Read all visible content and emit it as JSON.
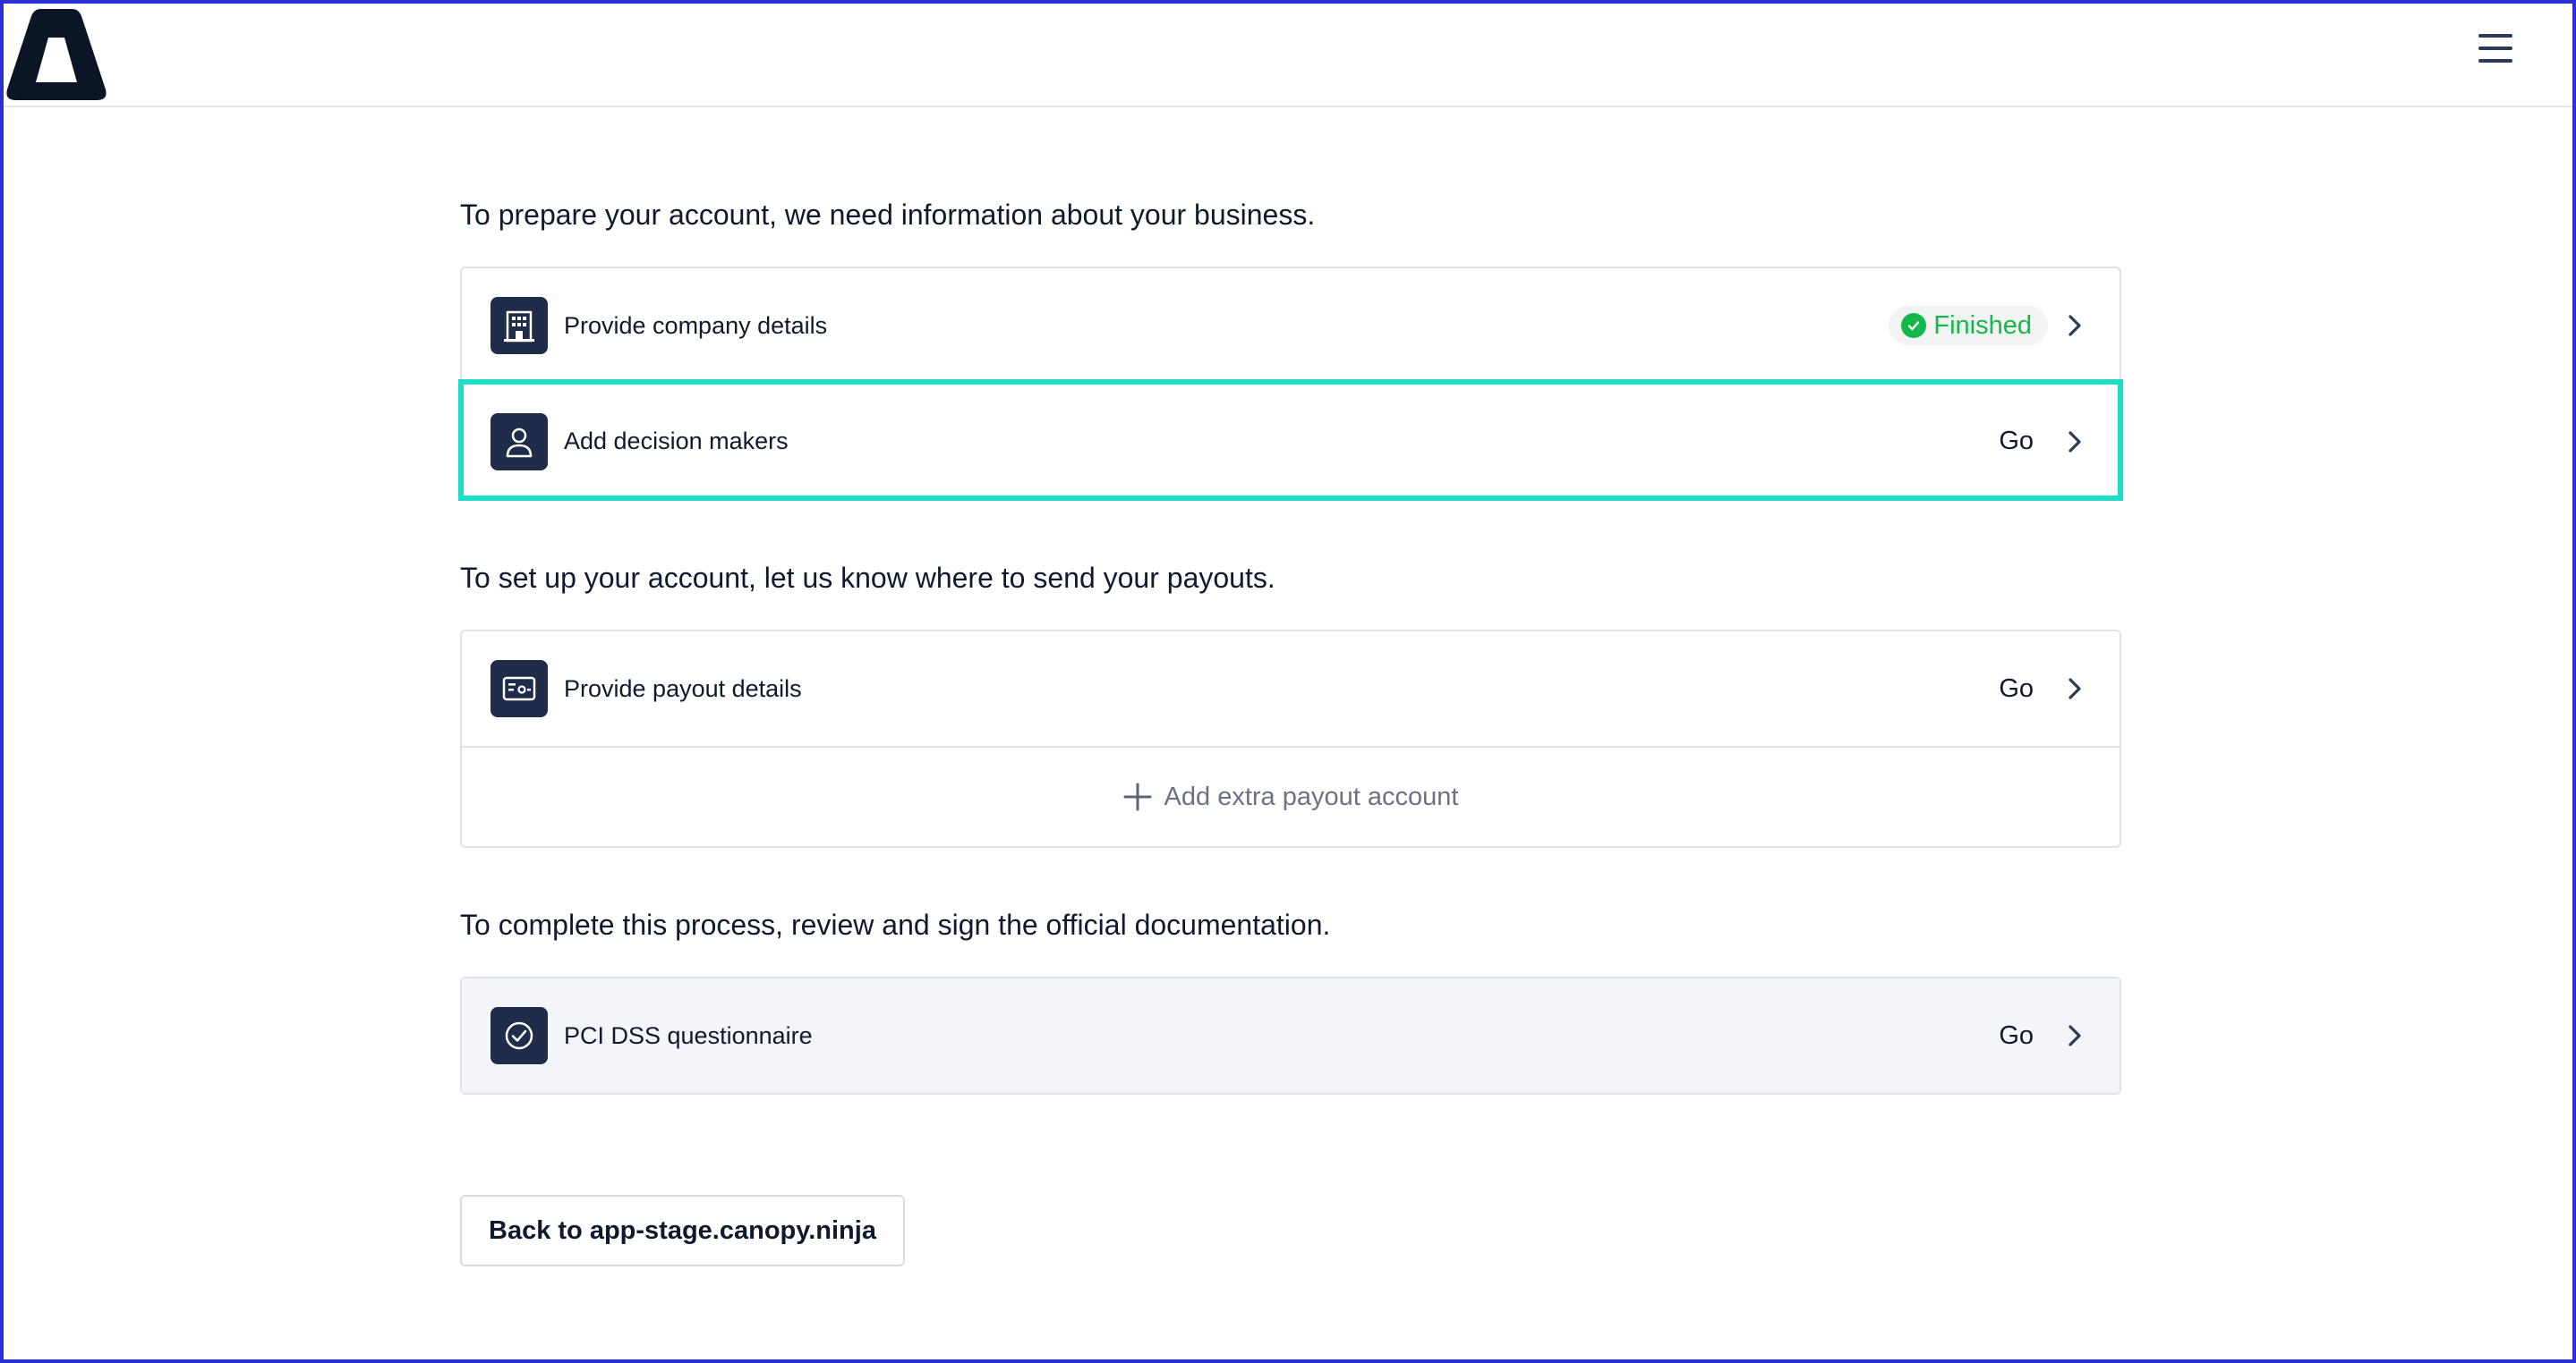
{
  "header": {
    "logo_icon": "triangle-logo-icon",
    "menu_icon": "hamburger-menu-icon"
  },
  "sections": [
    {
      "title": "To prepare your account, we need information about your business.",
      "rows": [
        {
          "label": "Provide company details",
          "icon": "building-icon",
          "status": "Finished",
          "status_type": "badge",
          "status_color": "#14b84a"
        },
        {
          "label": "Add decision makers",
          "icon": "person-icon",
          "status": "Go",
          "highlighted": true,
          "highlight_color": "#1fdcc8"
        }
      ]
    },
    {
      "title": "To set up your account, let us know where to send your payouts.",
      "rows": [
        {
          "label": "Provide payout details",
          "icon": "payout-card-icon",
          "status": "Go"
        }
      ],
      "add_action": {
        "label": "Add extra payout account",
        "icon": "plus-icon"
      }
    },
    {
      "title": "To complete this process, review and sign the official documentation.",
      "rows": [
        {
          "label": "PCI DSS questionnaire",
          "icon": "check-circle-icon",
          "status": "Go"
        }
      ]
    }
  ],
  "back_button": {
    "label": "Back to app-stage.canopy.ninja"
  },
  "colors": {
    "icon_tile": "#1f2d4a",
    "success": "#14b84a",
    "highlight": "#1fdcc8",
    "border": "#dfe2e7"
  }
}
